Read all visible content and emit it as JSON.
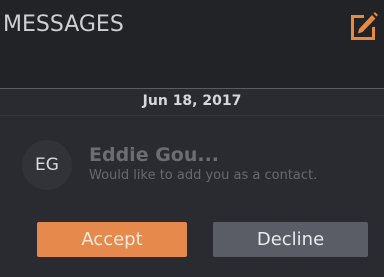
{
  "header": {
    "title": "MESSAGES",
    "compose_icon": "compose-edit-icon",
    "compose_color": "#e98a3f"
  },
  "thread": {
    "date": "Jun 18, 2017"
  },
  "request": {
    "avatar_initials": "EG",
    "name": "Eddie Gou...",
    "message": "Would like to add you as a contact."
  },
  "actions": {
    "accept_label": "Accept",
    "decline_label": "Decline",
    "accept_color": "#e5894c",
    "decline_color": "#5a5c66"
  }
}
